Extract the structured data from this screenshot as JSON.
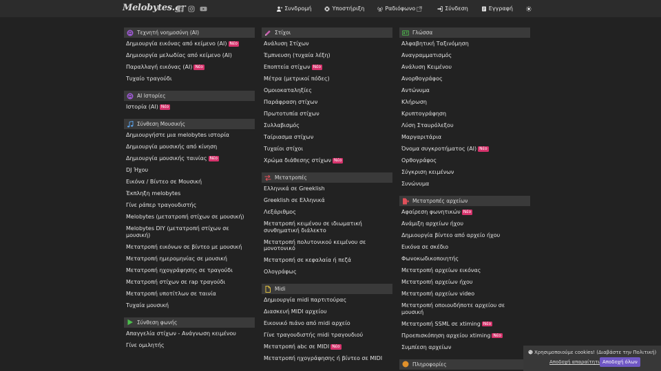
{
  "navbar": {
    "logo": "Melobytes.gr",
    "social": [
      "facebook-icon",
      "instagram-icon",
      "youtube-icon"
    ],
    "links": [
      {
        "label": "Συνδρομή",
        "icon": "user-plus-icon"
      },
      {
        "label": "Υποστήριξη",
        "icon": "lifebuoy-icon"
      },
      {
        "label": "Ραδιόφωνο",
        "icon": "radio-icon"
      },
      {
        "label": "Σύνδεση",
        "icon": "sign-in-icon"
      },
      {
        "label": "Εγγραφή",
        "icon": "register-icon"
      }
    ],
    "theme_toggle": "sun-icon"
  },
  "badge_label": "Νέο",
  "columns": [
    [
      {
        "title": "Τεχνητή νοημοσύνη (AI)",
        "icon": "ai-icon",
        "icon_color": "#9b59d0",
        "items": [
          {
            "label": "Δημιουργία εικόνας από κείμενο (AI)",
            "new": true
          },
          {
            "label": "Δημιουργία μελωδίας από κείμενο (AI)",
            "new": false
          },
          {
            "label": "Παραλλαγή εικόνας (AI)",
            "new": true
          },
          {
            "label": "Τυχαίο τραγούδι",
            "new": false
          }
        ]
      },
      {
        "title": "AI Ιστορίες",
        "icon": "ai-stories-icon",
        "icon_color": "#9b59d0",
        "items": [
          {
            "label": "Ιστορία (AI)",
            "new": true
          }
        ]
      },
      {
        "title": "Σύνθεση Μουσικής",
        "icon": "music-note-icon",
        "icon_color": "#5aa0e6",
        "items": [
          {
            "label": "Δημιουργήστε μια melobytes ιστορία",
            "new": false
          },
          {
            "label": "Δημιουργία μουσικής από κίνηση",
            "new": false
          },
          {
            "label": "Δημιουργία μουσικής ταινίας",
            "new": true
          },
          {
            "label": "DJ Ήχου",
            "new": false
          },
          {
            "label": "Εικόνα / Βίντεο σε Μουσική",
            "new": false
          },
          {
            "label": "Έκπληξη melobytes",
            "new": false
          },
          {
            "label": "Γίνε ράπερ τραγουδιστής",
            "new": false
          },
          {
            "label": "Melobytes (μετατροπή στίχων σε μουσική)",
            "new": false
          },
          {
            "label": "Melobytes DIY (μετατροπή στίχων σε μουσική)",
            "new": false
          },
          {
            "label": "Μετατροπή εικόνων σε βίντεο με μουσική",
            "new": false
          },
          {
            "label": "Μετατροπή ημερομηνίας σε μουσική",
            "new": false
          },
          {
            "label": "Μετατροπή ηχογράφησης σε τραγούδι",
            "new": false
          },
          {
            "label": "Μετατροπή στίχων σε rap τραγούδι",
            "new": false
          },
          {
            "label": "Μετατροπή υποτίτλων σε ταινία",
            "new": false
          },
          {
            "label": "Τυχαία μουσική",
            "new": false
          }
        ]
      },
      {
        "title": "Σύνθεση φωνής",
        "icon": "play-icon",
        "icon_color": "#4cc04c",
        "items": [
          {
            "label": "Απαγγελία στίχων - Ανάγνωση κειμένου",
            "new": false
          },
          {
            "label": "Γίνε ομιλητής",
            "new": false
          }
        ]
      }
    ],
    [
      {
        "title": "Στίχοι",
        "icon": "pencil-icon",
        "icon_color": "#c85fb0",
        "items": [
          {
            "label": "Ανάλυση Στίχων",
            "new": false
          },
          {
            "label": "Έμπνευση (τυχαία λέξη)",
            "new": false
          },
          {
            "label": "Εποπτεία στίχων",
            "new": true
          },
          {
            "label": "Μέτρα (μετρικοί πόδες)",
            "new": false
          },
          {
            "label": "Ομοιοκαταληξίες",
            "new": false
          },
          {
            "label": "Παράφραση στίχων",
            "new": false
          },
          {
            "label": "Πρωτοτυπία στίχων",
            "new": false
          },
          {
            "label": "Συλλαβισμός",
            "new": false
          },
          {
            "label": "Ταίριασμα στίχων",
            "new": false
          },
          {
            "label": "Τυχαίοι στίχοι",
            "new": false
          },
          {
            "label": "Χρώμα διάθεσης στίχων",
            "new": true
          }
        ]
      },
      {
        "title": "Μετατροπές",
        "icon": "swap-icon",
        "icon_color": "#e0505a",
        "items": [
          {
            "label": "Ελληνικά σε Greeklish",
            "new": false
          },
          {
            "label": "Greeklish σε Ελληνικά",
            "new": false
          },
          {
            "label": "Λεξάριθμος",
            "new": false
          },
          {
            "label": "Μετατροπή κειμένου σε ιδιωματική συνθηματική διάλεκτο",
            "new": false
          },
          {
            "label": "Μετατροπή πολυτονικού κειμένου σε μονοτονικό",
            "new": false
          },
          {
            "label": "Μετατροπή σε κεφαλαία ή πεζά",
            "new": false
          },
          {
            "label": "Ολογράφως",
            "new": false
          }
        ]
      },
      {
        "title": "Midi",
        "icon": "file-icon",
        "icon_color": "#e0c040",
        "items": [
          {
            "label": "Δημιουργία midi παρτιτούρας",
            "new": false
          },
          {
            "label": "Διασκευή MIDI αρχείου",
            "new": false
          },
          {
            "label": "Εικονικό πιάνο από midi αρχείο",
            "new": false
          },
          {
            "label": "Γίνε τραγουδιστής midi τραγουδιού",
            "new": false
          },
          {
            "label": "Μετατροπή abc σε MIDI",
            "new": true
          },
          {
            "label": "Μετατροπή ηχογράφησης ή βίντεο σε MIDI",
            "new": false
          }
        ]
      }
    ],
    [
      {
        "title": "Γλώσσα",
        "icon": "language-icon",
        "icon_color": "#4cc04c",
        "items": [
          {
            "label": "Αλφαβητική Ταξινόμηση",
            "new": false
          },
          {
            "label": "Αναγραμματισμός",
            "new": false
          },
          {
            "label": "Ανάλυση Κειμένου",
            "new": false
          },
          {
            "label": "Ανορθογράφος",
            "new": false
          },
          {
            "label": "Αντώνυμα",
            "new": false
          },
          {
            "label": "Κλήρωση",
            "new": false
          },
          {
            "label": "Κρυπτογράφηση",
            "new": false
          },
          {
            "label": "Λύση Σταυρόλεξου",
            "new": false
          },
          {
            "label": "Μαργαριτάρια",
            "new": false
          },
          {
            "label": "Όνομα συγκροτήματος (AI)",
            "new": true
          },
          {
            "label": "Ορθογράφος",
            "new": false
          },
          {
            "label": "Σύγκριση κειμένων",
            "new": false
          },
          {
            "label": "Συνώνυμα",
            "new": false
          }
        ]
      },
      {
        "title": "Μετατροπές αρχείων",
        "icon": "file-convert-icon",
        "icon_color": "#e0505a",
        "items": [
          {
            "label": "Αφαίρεση φωνητικών",
            "new": true
          },
          {
            "label": "Ανάμιξη αρχείων ήχου",
            "new": false
          },
          {
            "label": "Δημιουργία βίντεο από αρχείο ήχου",
            "new": false
          },
          {
            "label": "Εικόνα σε σκέδιο",
            "new": false
          },
          {
            "label": "Φωνοκωδικοποιητής",
            "new": false
          },
          {
            "label": "Μετατροπή αρχείων εικόνας",
            "new": false
          },
          {
            "label": "Μετατροπή αρχείων ήχου",
            "new": false
          },
          {
            "label": "Μετατροπή αρχείων video",
            "new": false
          },
          {
            "label": "Μετατροπή οποιουδήποτε αρχείου σε μουσική",
            "new": false
          },
          {
            "label": "Μετατροπή SSML σε xtiming",
            "new": true
          },
          {
            "label": "Προεπισκόπηση αρχείου xtiming",
            "new": true
          },
          {
            "label": "Συμπίεση αρχείων",
            "new": false
          }
        ]
      },
      {
        "title": "Πληροφορίες",
        "icon": "info-icon",
        "icon_color": "#e0902a",
        "items": []
      }
    ]
  ],
  "cookie": {
    "message": "Χρησιμοποιούμε cookies! (Διαβάστε την Πολιτική)",
    "reject_label": "Αποδοχή απαραίτητων",
    "accept_label": "Αποδοχή όλων"
  }
}
